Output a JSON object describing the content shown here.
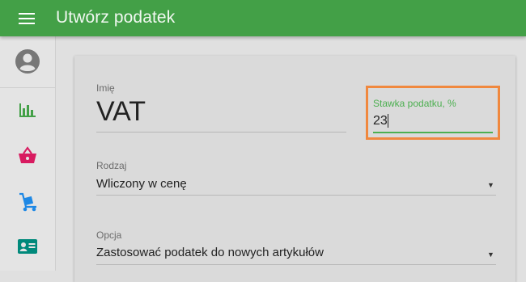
{
  "appbar": {
    "title": "Utwórz podatek",
    "menu_icon": "menu-icon",
    "color": "#43a047"
  },
  "sidebar": {
    "items": [
      {
        "name": "account-circle-icon",
        "color": "#777777"
      },
      {
        "name": "bar-chart-icon",
        "color": "#43a047"
      },
      {
        "name": "shopping-basket-icon",
        "color": "#d81b60"
      },
      {
        "name": "hand-truck-icon",
        "color": "#1e88e5"
      },
      {
        "name": "contact-card-icon",
        "color": "#00897b"
      }
    ]
  },
  "form": {
    "name_label": "Imię",
    "name_value": "VAT",
    "rate_label": "Stawka podatku, %",
    "rate_value": "23",
    "type_label": "Rodzaj",
    "type_value": "Wliczony w cenę",
    "option_label": "Opcja",
    "option_value": "Zastosować podatek do nowych artykułów"
  },
  "colors": {
    "accent": "#4caf50",
    "highlight_border": "#f0883e"
  }
}
